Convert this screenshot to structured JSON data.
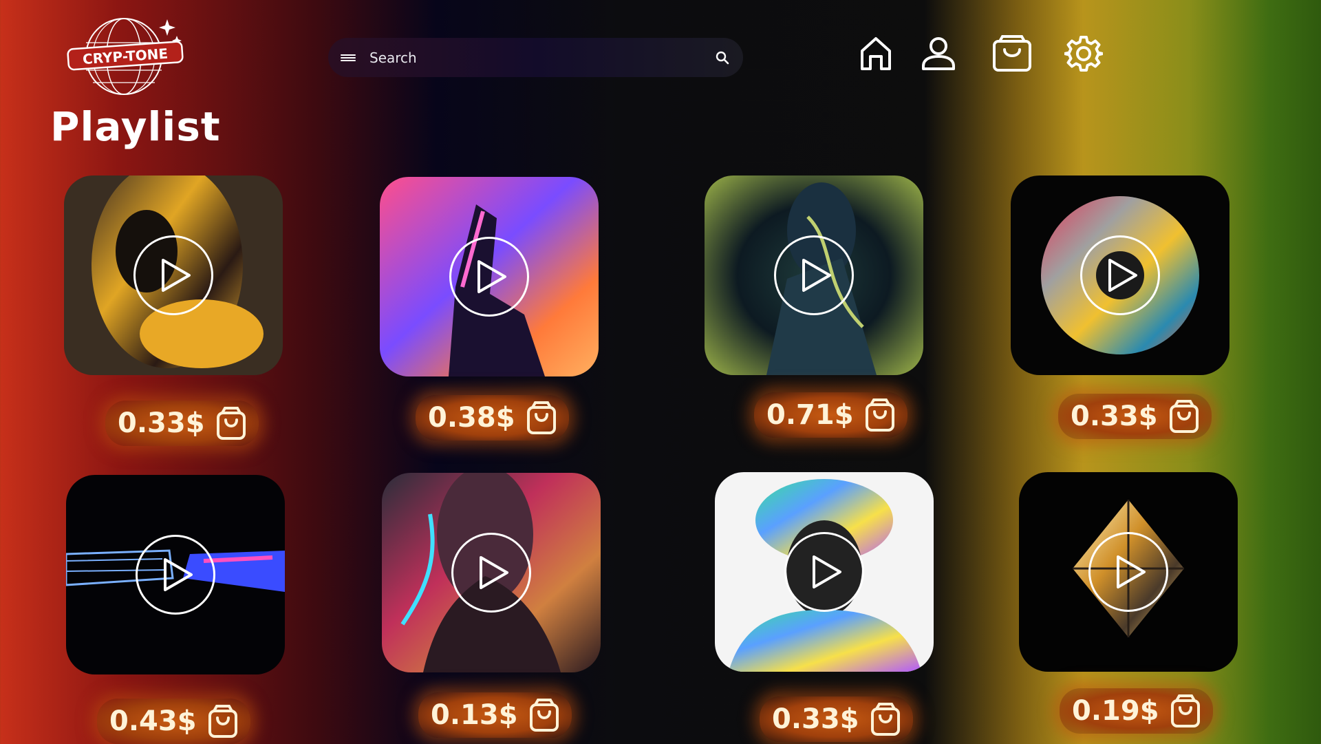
{
  "brand": {
    "logo_text": "CRYP-TONE"
  },
  "page": {
    "title": "Playlist"
  },
  "search": {
    "placeholder": "Search"
  },
  "nav": [
    "home-icon",
    "user-icon",
    "shopping-bag-icon",
    "gear-icon"
  ],
  "colors": {
    "price_glow": "#c65a12",
    "price_text": "#fff3d8"
  },
  "tracks": [
    {
      "price": "0.33$",
      "art": "chrome-head"
    },
    {
      "price": "0.38$",
      "art": "chrome-hand"
    },
    {
      "price": "0.71$",
      "art": "liquid-figure"
    },
    {
      "price": "0.33$",
      "art": "holographic-disc"
    },
    {
      "price": "0.43$",
      "art": "touching-hands"
    },
    {
      "price": "0.13$",
      "art": "neon-portrait"
    },
    {
      "price": "0.33$",
      "art": "holographic-medusa"
    },
    {
      "price": "0.19$",
      "art": "glowing-crystal"
    }
  ]
}
